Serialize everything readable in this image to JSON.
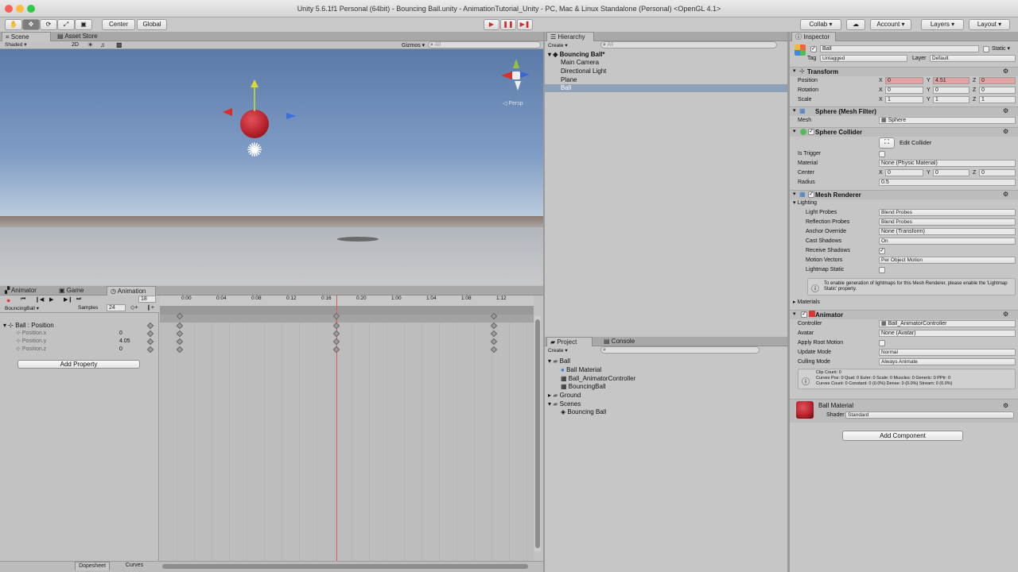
{
  "window": {
    "title": "Unity 5.6.1f1 Personal (64bit) - Bouncing Ball.unity - AnimationTutorial_Unity - PC, Mac & Linux Standalone (Personal) <OpenGL 4.1>"
  },
  "toolbar": {
    "center": "Center",
    "global": "Global",
    "collab": "Collab",
    "account": "Account",
    "layers": "Layers",
    "layout": "Layout"
  },
  "scene": {
    "tabs": [
      "Scene",
      "Asset Store"
    ],
    "shading": "Shaded",
    "mode2d": "2D",
    "gizmos": "Gizmos",
    "search": "All",
    "persp": "Persp"
  },
  "colors": {
    "accent": "#3d79c4",
    "selection": "#3e7ddb",
    "play_red": "#d02b2b",
    "record_red": "#e33",
    "ball": "#b8232e",
    "keyline": "#e05a5a"
  },
  "animation": {
    "tabs": [
      "Animator",
      "Game",
      "Animation"
    ],
    "clip": "BouncingBall",
    "samples_label": "Samples",
    "samples": "24",
    "frame": "18",
    "ruler": [
      "0:00",
      "0:04",
      "0:08",
      "0:12",
      "0:16",
      "0:20",
      "1:00",
      "1:04",
      "1:08",
      "1:12"
    ],
    "root": "Ball : Position",
    "props": [
      {
        "name": "Position.x",
        "value": "0"
      },
      {
        "name": "Position.y",
        "value": "4.05"
      },
      {
        "name": "Position.z",
        "value": "0"
      }
    ],
    "add_property": "Add Property",
    "bottom_tabs": [
      "Dopesheet",
      "Curves"
    ]
  },
  "hierarchy": {
    "tab": "Hierarchy",
    "create": "Create",
    "search": "All",
    "scene": "Bouncing Ball*",
    "items": [
      "Main Camera",
      "Directional Light",
      "Plane",
      "Ball"
    ]
  },
  "project": {
    "tabs": [
      "Project",
      "Console"
    ],
    "create": "Create",
    "items": [
      "Ball",
      "Ball Material",
      "Ball_AnimatorController",
      "BouncingBall",
      "Ground",
      "Scenes",
      "Bouncing Ball"
    ]
  },
  "inspector": {
    "tab": "Inspector",
    "name": "Ball",
    "static": "Static",
    "tag_label": "Tag",
    "tag": "Untagged",
    "layer_label": "Layer",
    "layer": "Default",
    "transform": {
      "title": "Transform",
      "rows": [
        {
          "label": "Position",
          "x": "0",
          "y": "4.51",
          "z": "0"
        },
        {
          "label": "Rotation",
          "x": "0",
          "y": "0",
          "z": "0"
        },
        {
          "label": "Scale",
          "x": "1",
          "y": "1",
          "z": "1"
        }
      ]
    },
    "mesh_filter": {
      "title": "Sphere (Mesh Filter)",
      "mesh_label": "Mesh",
      "mesh": "Sphere"
    },
    "collider": {
      "title": "Sphere Collider",
      "edit": "Edit Collider",
      "is_trigger": "Is Trigger",
      "material_label": "Material",
      "material": "None (Physic Material)",
      "center_label": "Center",
      "cx": "0",
      "cy": "0",
      "cz": "0",
      "radius_label": "Radius",
      "radius": "0.5"
    },
    "renderer": {
      "title": "Mesh Renderer",
      "lighting": "Lighting",
      "light_probes": "Light Probes",
      "light_probes_val": "Blend Probes",
      "reflection_probes": "Reflection Probes",
      "reflection_probes_val": "Blend Probes",
      "anchor": "Anchor Override",
      "anchor_val": "None (Transform)",
      "cast": "Cast Shadows",
      "cast_val": "On",
      "receive": "Receive Shadows",
      "motion": "Motion Vectors",
      "motion_val": "Per Object Motion",
      "lightmap": "Lightmap Static",
      "info": "To enable generation of lightmaps for this Mesh Renderer, please enable the 'Lightmap Static' property."
    },
    "materials": "Materials",
    "animator": {
      "title": "Animator",
      "controller_label": "Controller",
      "controller": "Ball_AnimatorController",
      "avatar_label": "Avatar",
      "avatar": "None (Avatar)",
      "root_motion": "Apply Root Motion",
      "update_label": "Update Mode",
      "update": "Normal",
      "culling_label": "Culling Mode",
      "culling": "Always Animate",
      "info1": "Clip Count: 0",
      "info2": "Curves Pos: 0 Quat: 0 Euler: 0 Scale: 0 Muscles: 0 Generic: 0 PPtr: 0",
      "info3": "Curves Count: 0 Constant: 0 (0.0%) Dense: 0 (0.0%) Stream: 0 (0.0%)"
    },
    "material": {
      "name": "Ball Material",
      "shader_label": "Shader",
      "shader": "Standard"
    },
    "add_component": "Add Component"
  }
}
